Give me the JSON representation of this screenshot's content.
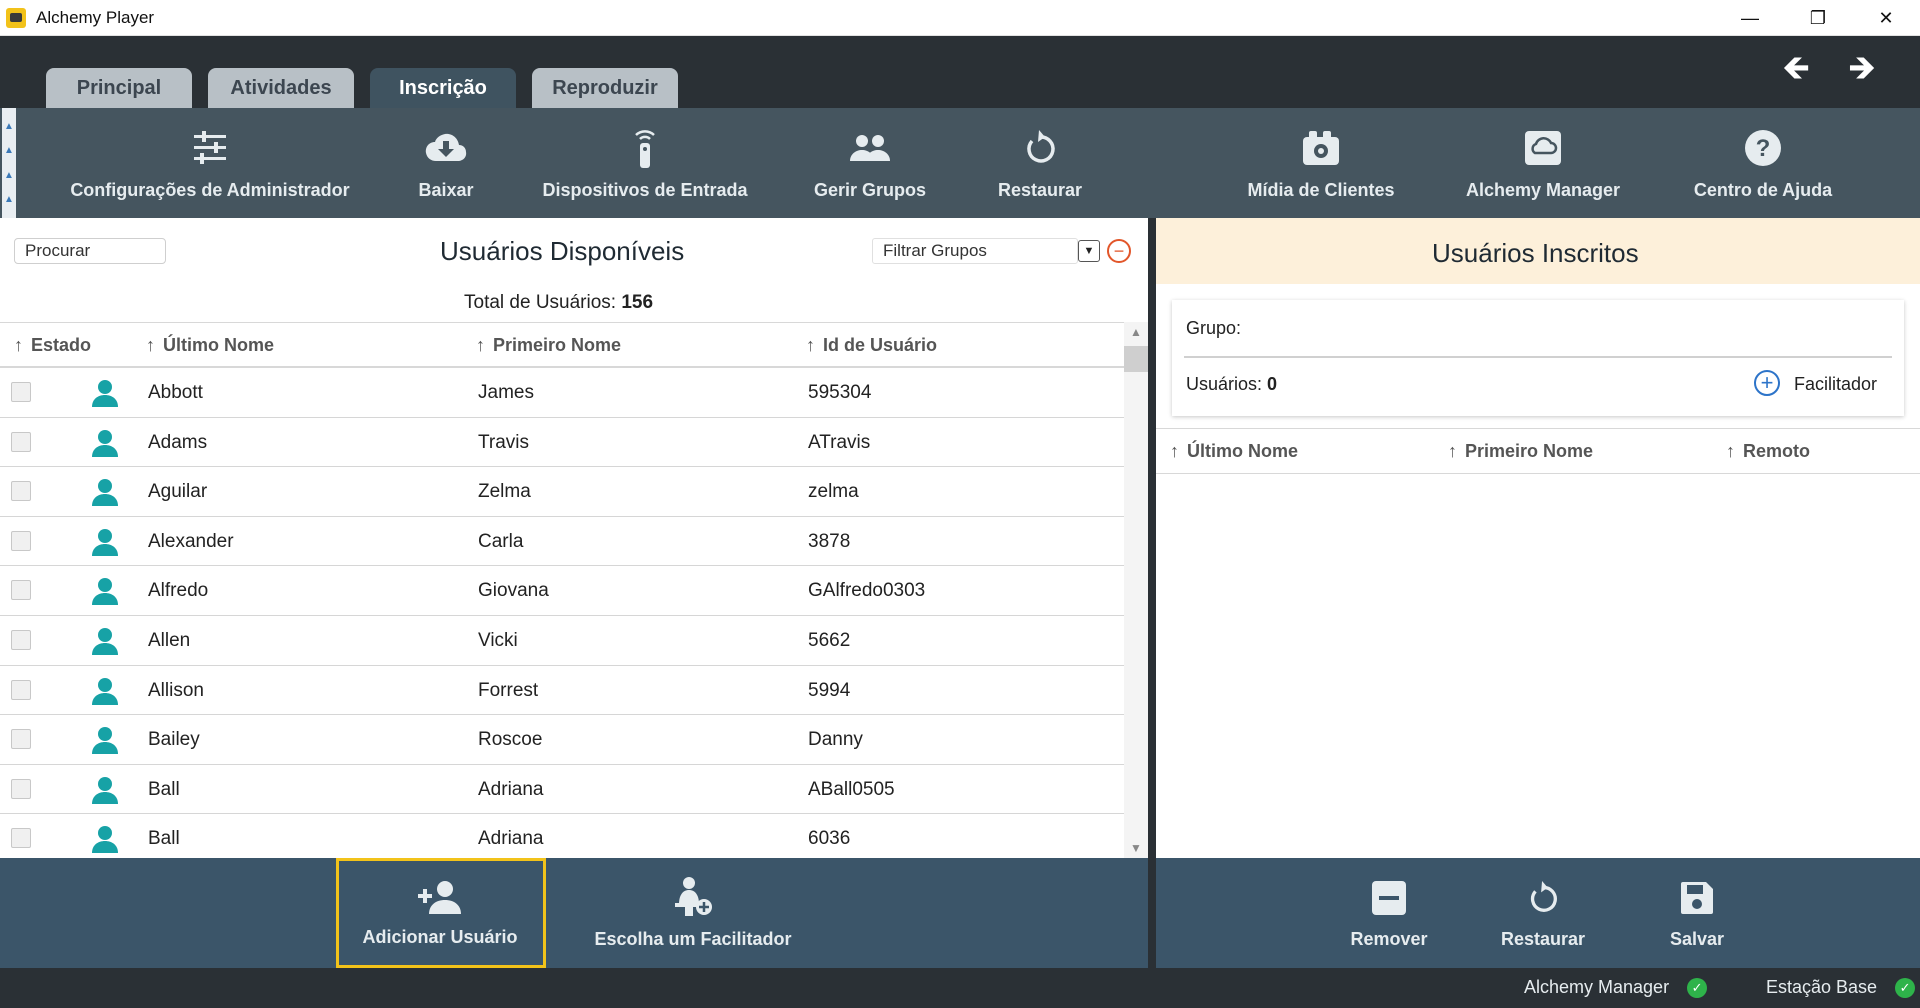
{
  "window": {
    "title": "Alchemy Player",
    "controls": {
      "minimize": "—",
      "restore": "❐",
      "close": "✕"
    }
  },
  "tabs": [
    {
      "label": "Principal",
      "active": false
    },
    {
      "label": "Atividades",
      "active": false
    },
    {
      "label": "Inscrição",
      "active": true
    },
    {
      "label": "Reproduzir",
      "active": false
    }
  ],
  "nav": {
    "back": "🡸",
    "forward": "🡺"
  },
  "toolbar": [
    {
      "label": "Configurações de Administrador",
      "icon": "sliders-icon"
    },
    {
      "label": "Baixar",
      "icon": "cloud-download-icon"
    },
    {
      "label": "Dispositivos de Entrada",
      "icon": "remote-control-icon"
    },
    {
      "label": "Gerir Grupos",
      "icon": "users-icon"
    },
    {
      "label": "Restaurar",
      "icon": "restore-icon"
    },
    {
      "label": "Mídia de Clientes",
      "icon": "media-icon"
    },
    {
      "label": "Alchemy Manager",
      "icon": "cloud-manager-icon"
    },
    {
      "label": "Centro de Ajuda",
      "icon": "help-icon"
    }
  ],
  "available": {
    "search_placeholder": "Procurar",
    "title": "Usuários Disponíveis",
    "filter_placeholder": "Filtrar Grupos",
    "total_label": "Total de Usuários:",
    "total_value": "156",
    "columns": [
      "Estado",
      "Último Nome",
      "Primeiro Nome",
      "Id de Usuário"
    ],
    "rows": [
      {
        "last": "Abbott",
        "first": "James",
        "id": "595304"
      },
      {
        "last": "Adams",
        "first": "Travis",
        "id": "ATravis"
      },
      {
        "last": "Aguilar",
        "first": "Zelma",
        "id": "zelma"
      },
      {
        "last": "Alexander",
        "first": "Carla",
        "id": "3878"
      },
      {
        "last": "Alfredo",
        "first": "Giovana",
        "id": "GAlfredo0303"
      },
      {
        "last": "Allen",
        "first": "Vicki",
        "id": "5662"
      },
      {
        "last": "Allison",
        "first": "Forrest",
        "id": "5994"
      },
      {
        "last": "Bailey",
        "first": "Roscoe",
        "id": "Danny"
      },
      {
        "last": "Ball",
        "first": "Adriana",
        "id": "ABall0505"
      },
      {
        "last": "Ball",
        "first": "Adriana",
        "id": "6036"
      }
    ]
  },
  "enrolled": {
    "title": "Usuários Inscritos",
    "group_label": "Grupo:",
    "users_label": "Usuários:",
    "users_value": "0",
    "facilitator_label": "Facilitador",
    "columns": [
      "Último Nome",
      "Primeiro Nome",
      "Remoto"
    ]
  },
  "bottom_left": {
    "add_user": "Adicionar Usuário",
    "choose_facilitator": "Escolha um Facilitador"
  },
  "bottom_right": {
    "remove": "Remover",
    "restore": "Restaurar",
    "save": "Salvar"
  },
  "status": {
    "manager": "Alchemy Manager",
    "base": "Estação Base"
  },
  "colors": {
    "accent_teal": "#17a2a6",
    "highlight": "#f2c31a",
    "ok_green": "#2eb34a"
  }
}
